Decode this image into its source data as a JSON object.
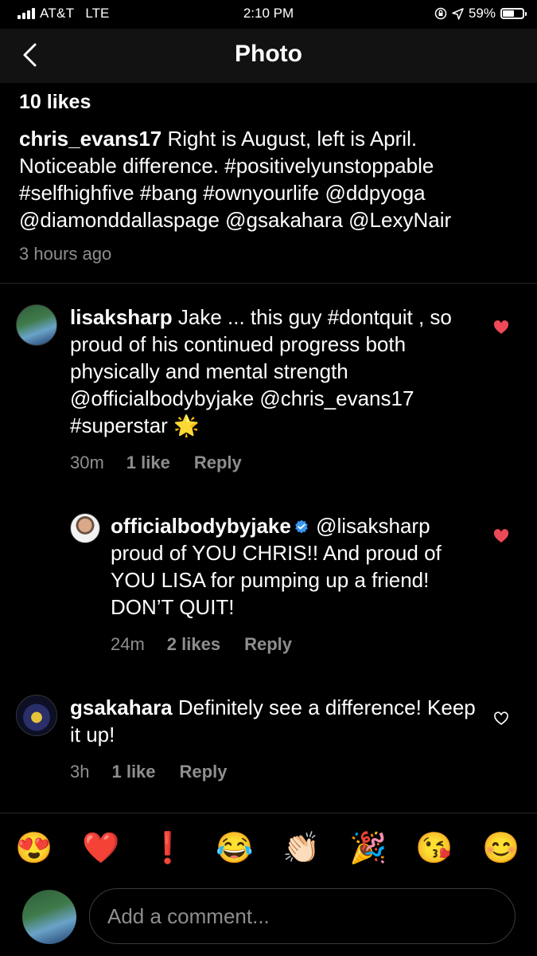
{
  "status_bar": {
    "carrier": "AT&T",
    "network": "LTE",
    "time": "2:10 PM",
    "battery": "59%",
    "battery_level": 0.59
  },
  "nav": {
    "title": "Photo",
    "back_icon": "chevron-left-icon"
  },
  "post": {
    "likes": "10 likes",
    "author": "chris_evans17",
    "caption": "Right is August, left is April. Noticeable difference. #positivelyunstoppable #selfhighfive #bang #ownyourlife @ddpyoga @diamonddallaspage @gsakahara @LexyNair",
    "time": "3 hours ago"
  },
  "comments": [
    {
      "user": "lisaksharp",
      "text": "Jake ... this guy #dontquit , so proud of his continued progress both physically and mental strength @officialbodybyjake @chris_evans17 #superstar 🌟",
      "time": "30m",
      "likes": "1 like",
      "reply": "Reply",
      "liked": true
    },
    {
      "user": "officialbodybyjake",
      "verified": true,
      "text": "@lisaksharp proud of YOU CHRIS!! And proud of YOU LISA for pumping up a friend! DON’T QUIT!",
      "time": "24m",
      "likes": "2 likes",
      "reply": "Reply",
      "liked": true
    },
    {
      "user": "gsakahara",
      "text": "Definitely see a difference!  Keep it up!",
      "time": "3h",
      "likes": "1 like",
      "reply": "Reply",
      "liked": false
    }
  ],
  "emoji_bar": [
    "😍",
    "❤️",
    "❗",
    "😂",
    "👏🏻",
    "🎉",
    "😘",
    "😊"
  ],
  "composer": {
    "placeholder": "Add a comment..."
  },
  "colors": {
    "heart": "#ed4956",
    "muted": "#8e8e8e",
    "verified": "#3897f0"
  }
}
